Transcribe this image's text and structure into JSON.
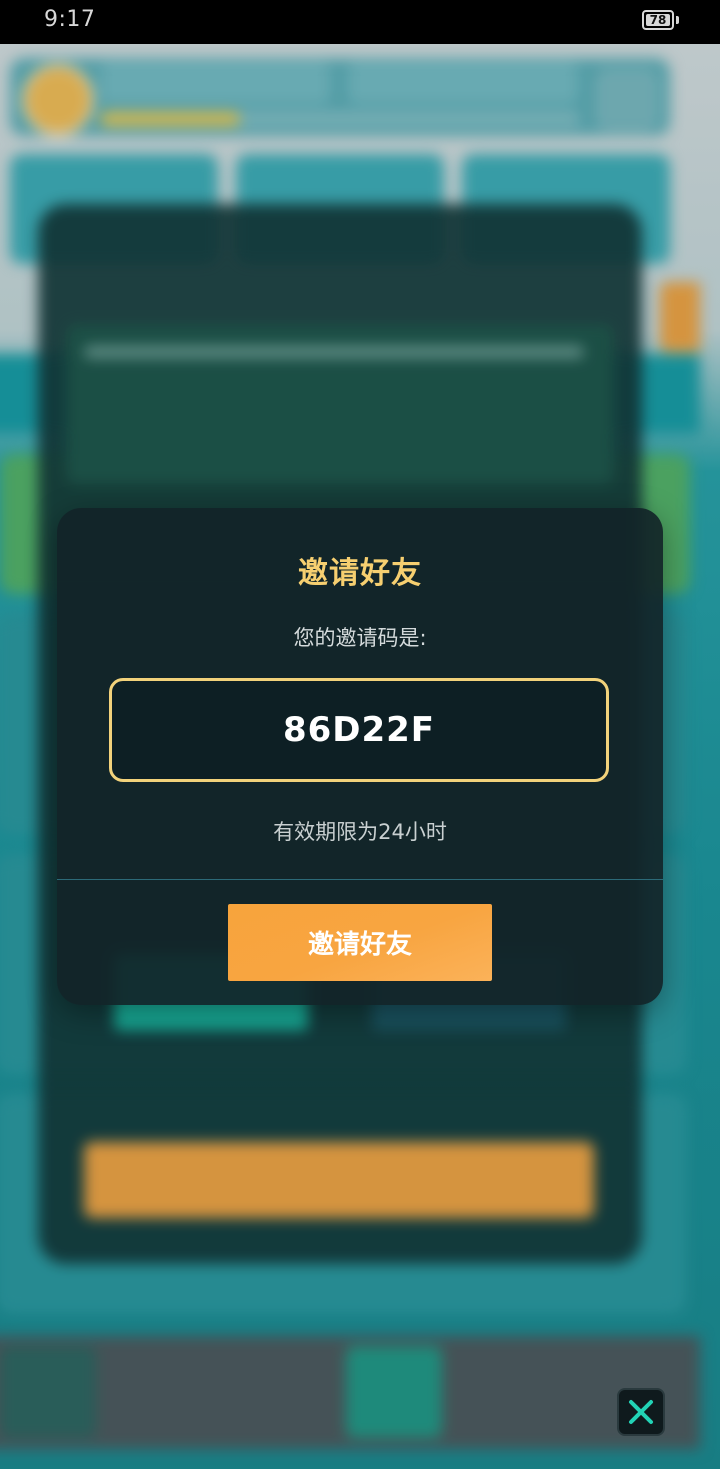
{
  "status_bar": {
    "time": "9:17",
    "battery": "78"
  },
  "dialog": {
    "title": "邀请好友",
    "code_label": "您的邀请码是:",
    "invite_code": "86D22F",
    "validity": "有效期限为24小时",
    "button_label": "邀请好友"
  },
  "colors": {
    "title_gold": "#f6cf70",
    "code_border": "#f2d27b",
    "button_orange": "#f8a541",
    "dialog_bg": "#122428"
  },
  "icons": {
    "close": "close-icon"
  }
}
